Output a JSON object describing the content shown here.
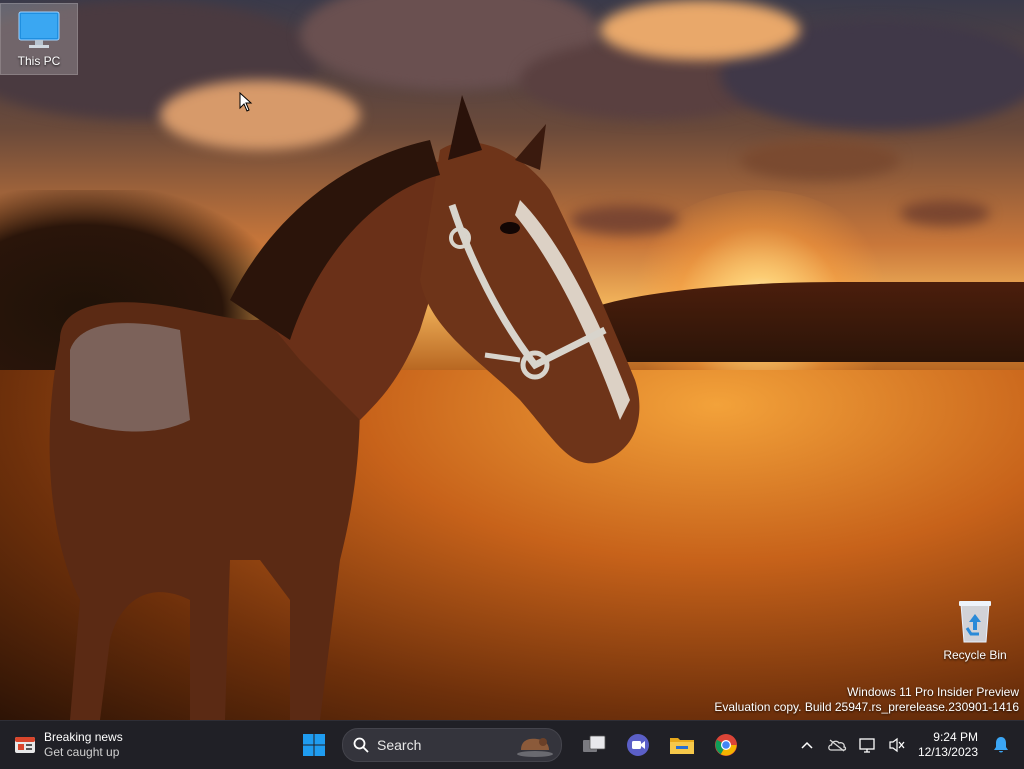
{
  "desktop": {
    "icons": [
      {
        "label": "This PC",
        "icon": "monitor-icon"
      },
      {
        "label": "Recycle Bin",
        "icon": "recycle-bin-icon"
      }
    ],
    "watermark": {
      "line1": "Windows 11 Pro Insider Preview",
      "line2": "Evaluation copy. Build 25947.rs_prerelease.230901-1416"
    }
  },
  "taskbar": {
    "widget": {
      "title": "Breaking news",
      "subtitle": "Get caught up",
      "icon": "news-icon"
    },
    "search": {
      "placeholder": "Search",
      "icon": "search-icon"
    },
    "pinned": [
      {
        "name": "Start",
        "icon": "windows-logo-icon"
      },
      {
        "name": "Task View",
        "icon": "task-view-icon"
      },
      {
        "name": "Meet",
        "icon": "video-call-icon"
      },
      {
        "name": "File Explorer",
        "icon": "folder-icon"
      },
      {
        "name": "Google Chrome",
        "icon": "chrome-icon"
      }
    ],
    "tray": {
      "time": "9:24 PM",
      "date": "12/13/2023",
      "icons": [
        "chevron-up-icon",
        "onedrive-icon",
        "network-icon",
        "volume-muted-icon",
        "notification-bell-icon"
      ]
    }
  },
  "colors": {
    "taskbar_bg": "#202026",
    "accent": "#0a74d6"
  }
}
